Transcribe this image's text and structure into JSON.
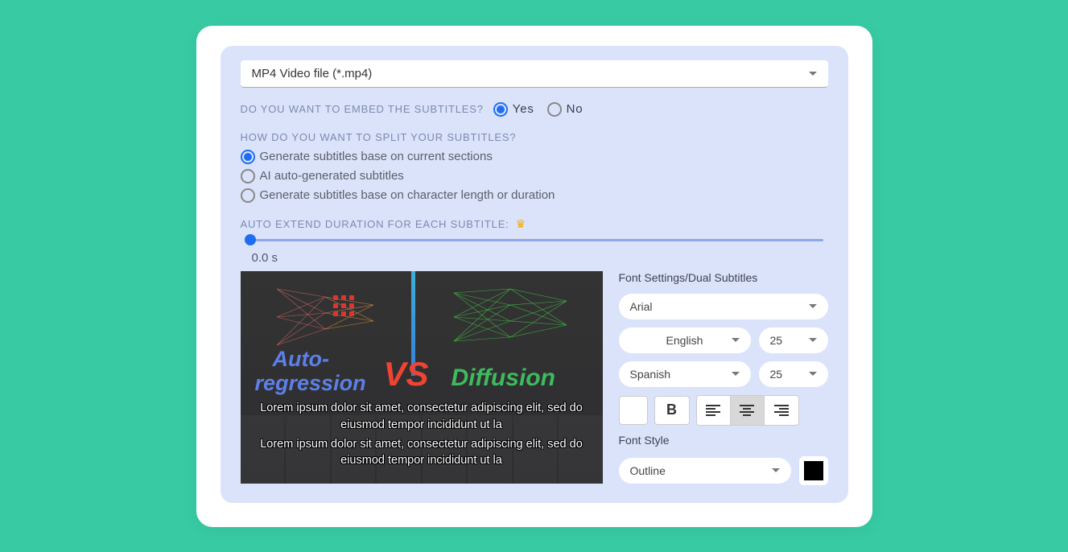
{
  "file_select": {
    "label": "MP4 Video file (*.mp4)"
  },
  "embed": {
    "question": "DO YOU WANT TO EMBED THE SUBTITLES?",
    "yes": "Yes",
    "no": "No",
    "selected": "yes"
  },
  "split": {
    "question": "HOW DO YOU WANT TO SPLIT YOUR SUBTITLES?",
    "options": [
      "Generate subtitles base on current sections",
      "AI auto-generated subtitles",
      "Generate subtitles base on character length or duration"
    ],
    "selected": 0
  },
  "auto_extend": {
    "label": "AUTO EXTEND DURATION FOR EACH SUBTITLE:",
    "value": "0.0 s"
  },
  "preview": {
    "word_auto": "Auto-",
    "word_regression": "regression",
    "word_vs": "VS",
    "word_diffusion": "Diffusion",
    "sub1": "Lorem ipsum dolor sit amet, consectetur adipiscing elit, sed do eiusmod tempor incididunt ut la",
    "sub2": "Lorem ipsum dolor sit amet, consectetur adipiscing elit, sed do eiusmod tempor incididunt ut la"
  },
  "settings": {
    "title": "Font Settings/Dual Subtitles",
    "font": "Arial",
    "lang1": "English",
    "size1": "25",
    "lang2": "Spanish",
    "size2": "25",
    "bold_label": "B",
    "font_style_label": "Font Style",
    "font_style": "Outline",
    "alignment": "center",
    "text_color": "#ffffff",
    "outline_color": "#000000"
  }
}
